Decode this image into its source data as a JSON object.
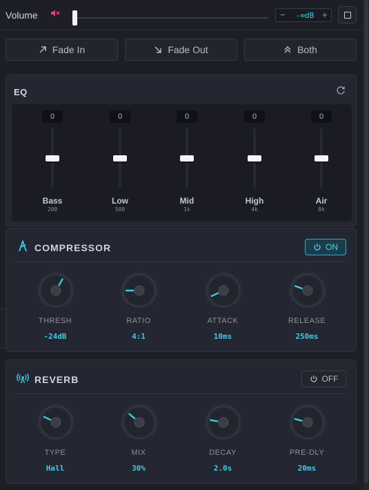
{
  "volume": {
    "label": "Volume",
    "level": 0.0,
    "db_minus": "−",
    "db_value": "-∞dB",
    "db_plus": "+"
  },
  "fade": {
    "fade_in": "Fade In",
    "fade_out": "Fade Out",
    "both": "Both"
  },
  "eq": {
    "title": "EQ",
    "bands": [
      {
        "value": "0",
        "name": "Bass",
        "freq": "200"
      },
      {
        "value": "0",
        "name": "Low",
        "freq": "500"
      },
      {
        "value": "0",
        "name": "Mid",
        "freq": "1k"
      },
      {
        "value": "0",
        "name": "High",
        "freq": "4k"
      },
      {
        "value": "0",
        "name": "Air",
        "freq": "8k"
      }
    ]
  },
  "compressor": {
    "title": "COMPRESSOR",
    "toggle": "ON",
    "enabled": true,
    "knobs": [
      {
        "label": "THRESH",
        "value": "-24dB",
        "angle_deg": 30
      },
      {
        "label": "RATIO",
        "value": "4:1",
        "angle_deg": -90
      },
      {
        "label": "ATTACK",
        "value": "10ms",
        "angle_deg": -115
      },
      {
        "label": "RELEASE",
        "value": "250ms",
        "angle_deg": -70
      }
    ]
  },
  "reverb": {
    "title": "REVERB",
    "toggle": "OFF",
    "enabled": false,
    "knobs": [
      {
        "label": "TYPE",
        "value": "Hall",
        "angle_deg": -65
      },
      {
        "label": "MIX",
        "value": "30%",
        "angle_deg": -50
      },
      {
        "label": "DECAY",
        "value": "2.0s",
        "angle_deg": -80
      },
      {
        "label": "PRE-DLY",
        "value": "20ms",
        "angle_deg": -75
      }
    ]
  },
  "colors": {
    "accent": "#3ecbe6",
    "mute": "#e0408a",
    "background": "#1d1e26",
    "panel": "#242632"
  },
  "icons": {
    "mute": "speaker-muted-icon",
    "expand": "square-icon",
    "fade_in": "arrow-up-right-icon",
    "fade_out": "arrow-down-right-icon",
    "both": "double-chevron-up-icon",
    "reset": "refresh-icon",
    "compressor": "compressor-icon",
    "reverb": "antenna-icon",
    "power": "power-icon"
  }
}
